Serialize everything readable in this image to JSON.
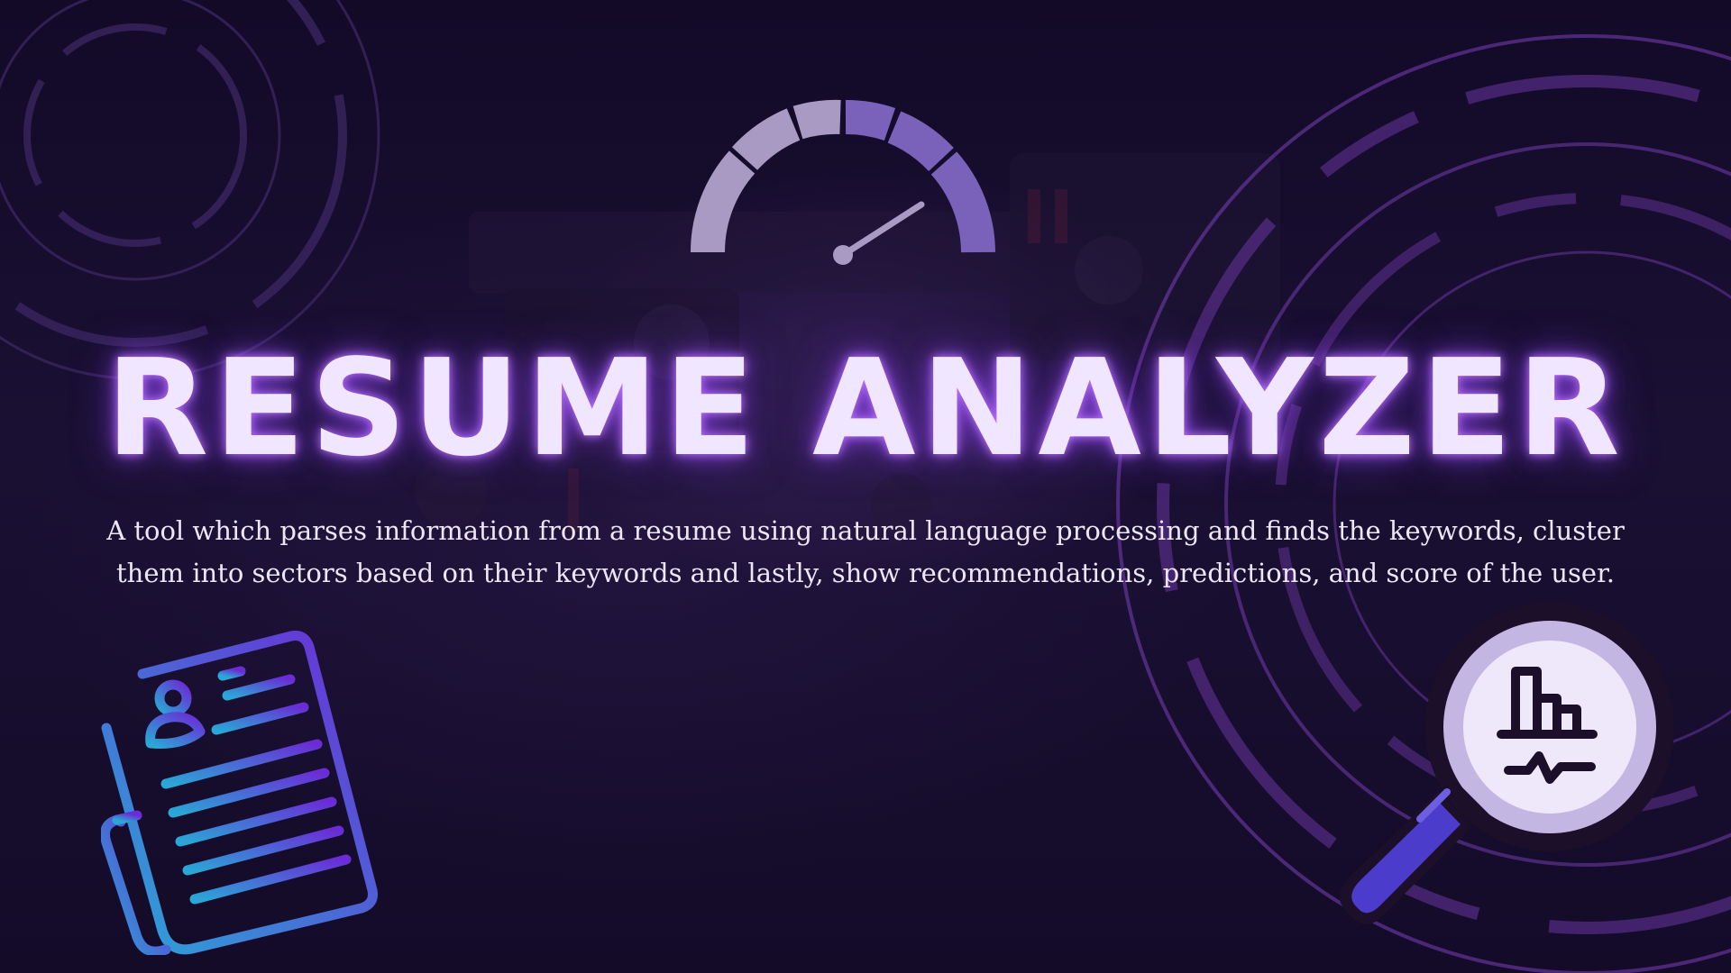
{
  "title": "RESUME ANALYZER",
  "description": "A tool which parses information from a resume using natural language processing and finds the keywords, cluster them into sectors based on their keywords and lastly, show recommendations, predictions, and score of the user.",
  "colors": {
    "background": "#150c2a",
    "accent_purple": "#8a5cc9",
    "title_glow": "#b46cff",
    "title_text": "#f1e6ff",
    "icon_gradient_start": "#2aa7d6",
    "icon_gradient_end": "#6b2bd6",
    "magnifier_handle": "#4b3ccc"
  },
  "icons": {
    "gauge": "speedometer-gauge-icon",
    "document": "resume-document-icon",
    "magnifier": "analytics-magnifier-icon"
  }
}
